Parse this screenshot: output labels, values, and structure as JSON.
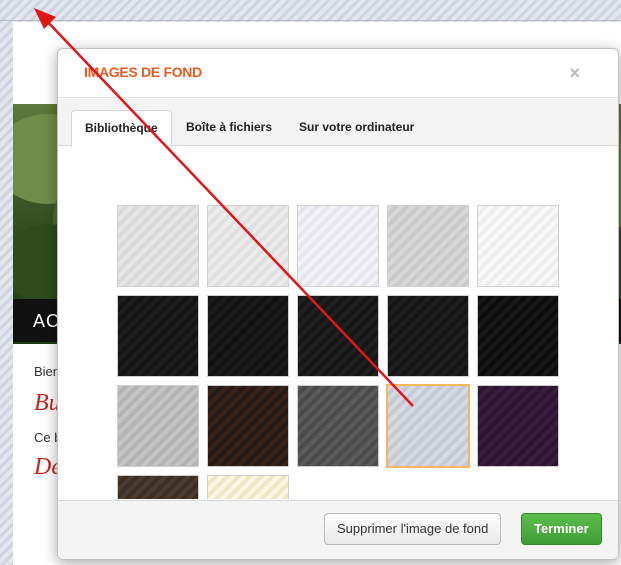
{
  "background_page": {
    "nav_text": "AC",
    "text_1": "Bien",
    "red_1": "Bu",
    "text_2": "Ce b",
    "red_2": "De"
  },
  "modal": {
    "title": "IMAGES DE FOND",
    "close_glyph": "×",
    "tabs": [
      {
        "label": "Bibliothèque",
        "active": true
      },
      {
        "label": "Boîte à fichiers",
        "active": false
      },
      {
        "label": "Sur votre ordinateur",
        "active": false
      }
    ],
    "thumbnails": [
      {
        "color_a": "#e6e6e6",
        "color_b": "#d9d9d9",
        "selected": false
      },
      {
        "color_a": "#ececec",
        "color_b": "#e0e0e0",
        "selected": false
      },
      {
        "color_a": "#f3f3f7",
        "color_b": "#e6e6ec",
        "selected": false
      },
      {
        "color_a": "#d8d8d8",
        "color_b": "#cacaca",
        "selected": false
      },
      {
        "color_a": "#f9f9f9",
        "color_b": "#eeeeee",
        "selected": false
      },
      {
        "color_a": "#141414",
        "color_b": "#1d1d1d",
        "selected": false
      },
      {
        "color_a": "#121212",
        "color_b": "#1a1a1a",
        "selected": false
      },
      {
        "color_a": "#161616",
        "color_b": "#202020",
        "selected": false
      },
      {
        "color_a": "#151515",
        "color_b": "#1e1e1e",
        "selected": false
      },
      {
        "color_a": "#0c0c0c",
        "color_b": "#181818",
        "selected": false
      },
      {
        "color_a": "#c4c4c4",
        "color_b": "#b3b3b3",
        "selected": false
      },
      {
        "color_a": "#241b18",
        "color_b": "#3a2219",
        "selected": false
      },
      {
        "color_a": "#5a5a5a",
        "color_b": "#4a4a4a",
        "selected": false
      },
      {
        "color_a": "#d6dae3",
        "color_b": "#c5cad5",
        "selected": true
      },
      {
        "color_a": "#3a1d3f",
        "color_b": "#2d1631",
        "selected": false
      },
      {
        "color_a": "#4a3c30",
        "color_b": "#3a2e25",
        "selected": false
      },
      {
        "color_a": "#fbf7e4",
        "color_b": "#efe6c4",
        "selected": false
      }
    ],
    "delete_button": "Supprimer l'image de fond",
    "done_button": "Terminer"
  },
  "annotation": {
    "arrow_color": "#e0161b"
  }
}
